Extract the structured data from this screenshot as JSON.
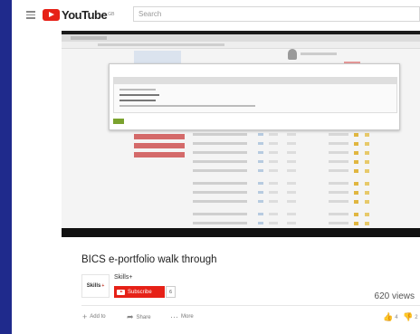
{
  "header": {
    "logo_text": "YouTube",
    "logo_region": "GB",
    "search_placeholder": "Search"
  },
  "video": {
    "title": "BICS e-portfolio walk through",
    "views": "620 views"
  },
  "channel": {
    "name": "Skills+",
    "logo_text": "Skills",
    "logo_mark": "+",
    "subscribe_label": "Subscribe",
    "subscriber_count": "6"
  },
  "actions": {
    "add_to": "Add to",
    "share": "Share",
    "more": "More",
    "likes": "4",
    "dislikes": "2"
  },
  "colors": {
    "background": "#1f2a8c",
    "brand_red": "#e62117"
  }
}
